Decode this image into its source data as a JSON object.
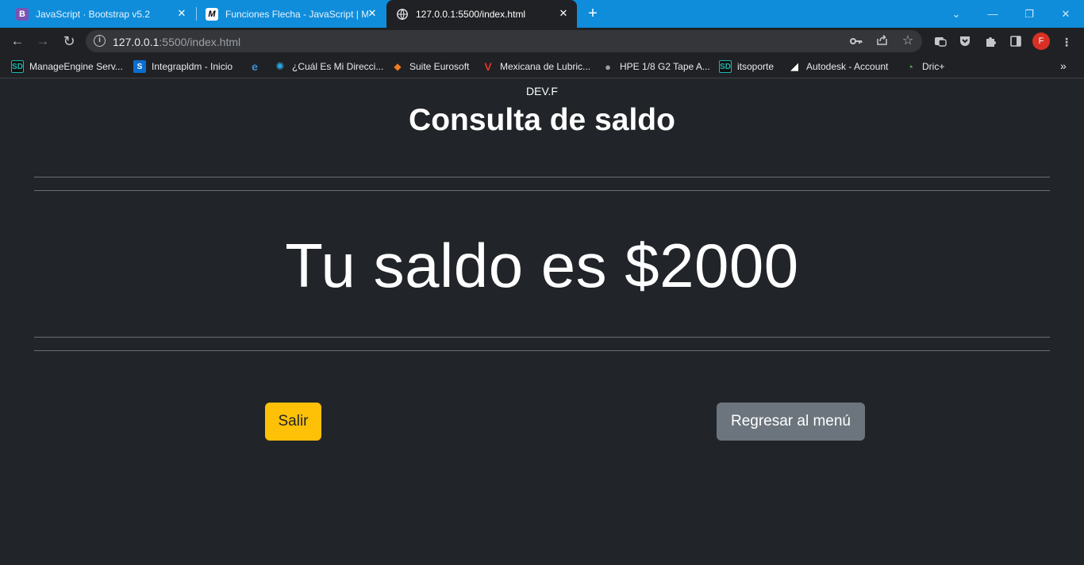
{
  "browser": {
    "tabs": [
      {
        "title": "JavaScript · Bootstrap v5.2",
        "favicon": "B",
        "favicon_color": "#7952b3",
        "state": "inactive"
      },
      {
        "title": "Funciones Flecha - JavaScript | M",
        "favicon": "M",
        "favicon_color": "#000000",
        "state": "inactive"
      },
      {
        "title": "127.0.0.1:5500/index.html",
        "favicon": "globe-icon",
        "state": "active"
      }
    ],
    "tab_close_glyph": "✕",
    "new_tab_glyph": "+",
    "window_controls": {
      "dropdown": "⌄",
      "minimize": "—",
      "restore": "❐",
      "close": "✕"
    },
    "address": {
      "host": "127.0.0.1",
      "path": ":5500/index.html"
    },
    "nav": {
      "back": "←",
      "forward": "→",
      "reload": "↻"
    },
    "profile_initial": "F",
    "bookmarks": [
      {
        "label": "ManageEngine Serv...",
        "icon": "SD",
        "color": "#1fb5ad"
      },
      {
        "label": "Integrapldm - Inicio",
        "icon": "S",
        "color": "#0a6ed1"
      },
      {
        "label": "",
        "icon": "e",
        "color": "#3b8ed8"
      },
      {
        "label": "¿Cuál Es Mi Direcci...",
        "icon": "✺",
        "color": "#29a8df"
      },
      {
        "label": "Suite Eurosoft",
        "icon": "◆",
        "color": "#f47b20"
      },
      {
        "label": "Mexicana de Lubric...",
        "icon": "V",
        "color": "#d8382c"
      },
      {
        "label": "HPE 1/8 G2 Tape A...",
        "icon": "●",
        "color": "#9aa0a6"
      },
      {
        "label": "itsoporte",
        "icon": "SD",
        "color": "#1fb5ad"
      },
      {
        "label": "Autodesk - Account",
        "icon": "◢",
        "color": "#ffffff"
      },
      {
        "label": "Dric+",
        "icon": "◔",
        "color": "#4caf50"
      }
    ],
    "bookmarks_more": "»"
  },
  "page": {
    "brand": "DEV.F",
    "title": "Consulta de saldo",
    "balance_text": "Tu saldo es $2000",
    "buttons": {
      "exit": "Salir",
      "back_to_menu": "Regresar al menú"
    },
    "colors": {
      "background": "#212529",
      "exit_button": "#ffc107",
      "menu_button": "#6c757d"
    }
  }
}
